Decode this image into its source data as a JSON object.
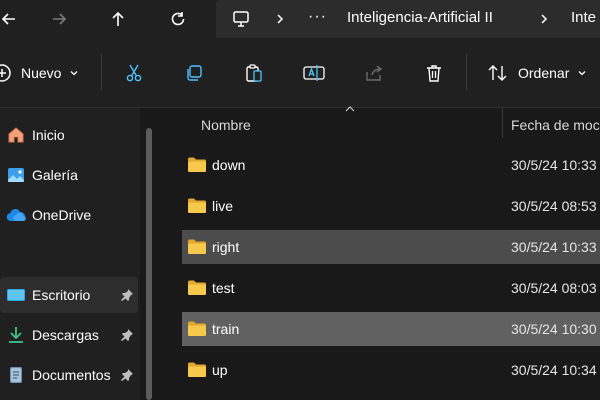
{
  "address_bar": {
    "breadcrumb": [
      "Inteligencia-Artificial II",
      "Inte"
    ]
  },
  "toolbar": {
    "new_label": "Nuevo",
    "sort_label": "Ordenar"
  },
  "sidebar": {
    "items": [
      {
        "label": "Inicio",
        "icon": "home-icon"
      },
      {
        "label": "Galería",
        "icon": "gallery-icon"
      },
      {
        "label": "OneDrive",
        "icon": "onedrive-cloud-icon"
      },
      {
        "label": "Escritorio",
        "icon": "desktop-icon",
        "pinned": true,
        "selected": true
      },
      {
        "label": "Descargas",
        "icon": "download-icon",
        "pinned": true
      },
      {
        "label": "Documentos",
        "icon": "documents-icon",
        "pinned": true
      }
    ]
  },
  "list": {
    "columns": [
      "Nombre",
      "Fecha de moc"
    ],
    "rows": [
      {
        "name": "down",
        "date": "30/5/24 10:33",
        "state": "normal"
      },
      {
        "name": "live",
        "date": "30/5/24 08:53",
        "state": "normal"
      },
      {
        "name": "right",
        "date": "30/5/24 10:33",
        "state": "selected"
      },
      {
        "name": "test",
        "date": "30/5/24 08:03",
        "state": "normal"
      },
      {
        "name": "train",
        "date": "30/5/24 10:30",
        "state": "hover-selected"
      },
      {
        "name": "up",
        "date": "30/5/24 10:34",
        "state": "normal"
      }
    ]
  },
  "colors": {
    "folder": "#f6c94c",
    "accent_blue": "#4cc2ff"
  }
}
